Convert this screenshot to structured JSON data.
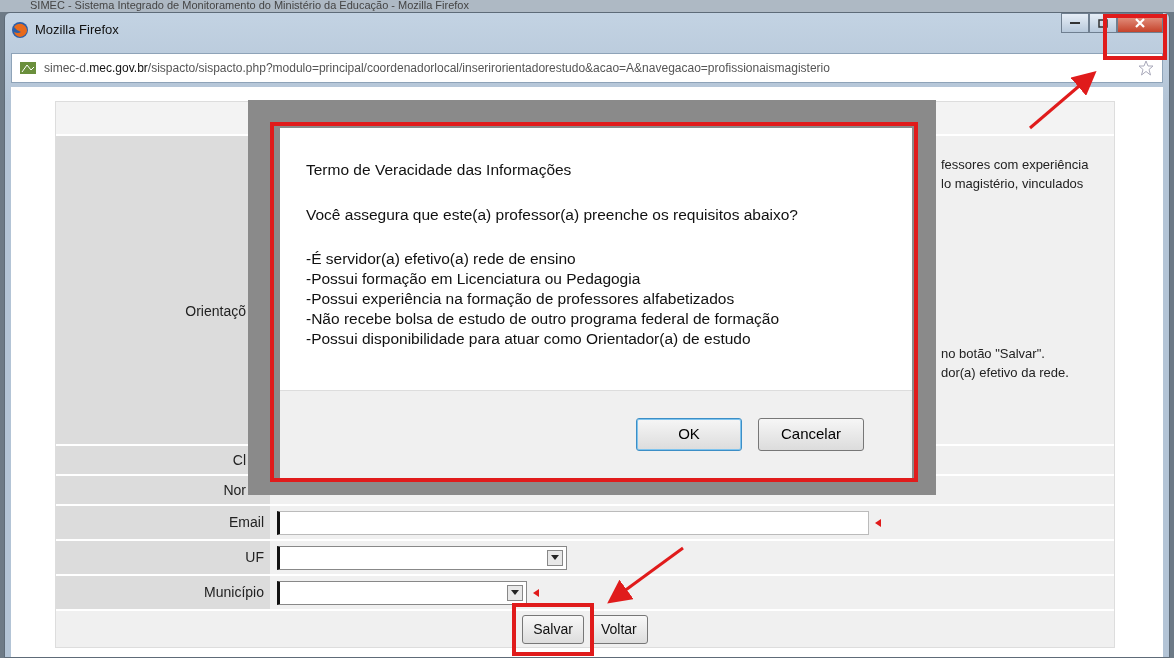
{
  "outer_window": {
    "title": "SIMEC - Sistema Integrado de Monitoramento do Ministério da Educação - Mozilla Firefox"
  },
  "window": {
    "title": "Mozilla Firefox",
    "close_highlighted": true,
    "address": "simec-d.**mec.gov.br**/sispacto/sispacto.php?modulo=principal/coordenadorlocal/inserirorientadorestudo&acao=A&navegacao=profissionaismagisterio"
  },
  "form": {
    "intro_label": "Orientaçõ",
    "intro_right": [
      "fessores com experiência",
      "lo magistério, vinculados"
    ],
    "notes_right": [
      "no botão \"Salvar\".",
      "dor(a) efetivo da rede."
    ],
    "fields": [
      {
        "label": "Cl",
        "kind": "covered",
        "required": false
      },
      {
        "label": "Nor",
        "kind": "covered",
        "required": false
      },
      {
        "label": "Email",
        "kind": "text",
        "required": true
      },
      {
        "label": "UF",
        "kind": "select",
        "required": false
      },
      {
        "label": "Município",
        "kind": "select",
        "required": true
      }
    ],
    "buttons": [
      {
        "label": "Salvar",
        "highlighted": true
      },
      {
        "label": "Voltar",
        "highlighted": false
      }
    ]
  },
  "dialog": {
    "highlighted": true,
    "title": "Termo de Veracidade das Informações",
    "question": "Você assegura que este(a) professor(a) preenche os requisitos abaixo?",
    "requirements": [
      "-É servidor(a) efetivo(a) rede de ensino",
      "-Possui formação em Licenciatura ou Pedagogia",
      "-Possui experiência na formação de professores alfabetizados",
      "-Não recebe bolsa de estudo de outro programa federal de formação",
      "-Possui disponibilidade para atuar como Orientador(a) de estudo"
    ],
    "buttons": [
      {
        "label": "OK",
        "default": true
      },
      {
        "label": "Cancelar",
        "default": false
      }
    ]
  }
}
